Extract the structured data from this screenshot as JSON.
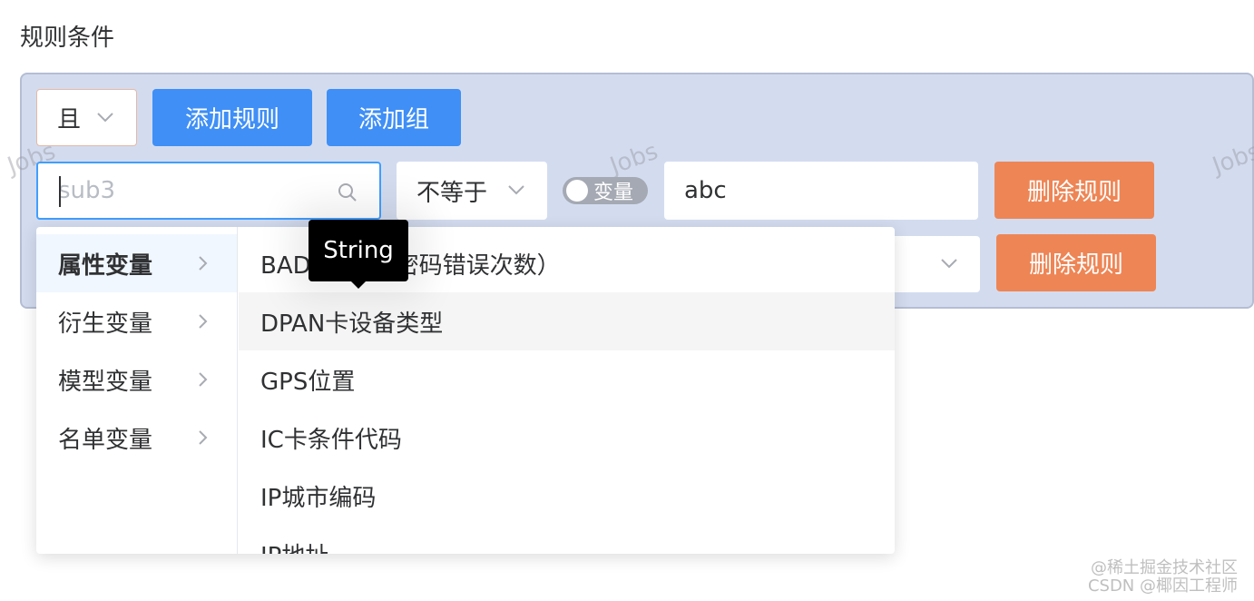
{
  "title": "规则条件",
  "watermark": "Jobs",
  "toolbar": {
    "logic_value": "且",
    "add_rule_label": "添加规则",
    "add_group_label": "添加组"
  },
  "rule1": {
    "field_value": "sub3",
    "operator": "不等于",
    "toggle_label": "变量",
    "value": "abc",
    "delete_label": "删除规则"
  },
  "rule2": {
    "delete_label": "删除规则"
  },
  "cascader": {
    "categories": [
      {
        "label": "属性变量",
        "active": true
      },
      {
        "label": "衍生变量",
        "active": false
      },
      {
        "label": "模型变量",
        "active": false
      },
      {
        "label": "名单变量",
        "active": false
      }
    ],
    "options": [
      "BAD  RIES（密码错误次数）",
      "DPAN卡设备类型",
      "GPS位置",
      "IC卡条件代码",
      "IP城市编码",
      "IP地址"
    ],
    "hovered_option_index": 1
  },
  "tooltip": {
    "text": "String"
  },
  "footer": {
    "line1": "@稀土掘金技术社区",
    "line2": "CSDN @椰因工程师"
  },
  "colors": {
    "primary": "#3f8ff6",
    "danger": "#ee8555",
    "panel_bg": "#d3dcef"
  }
}
